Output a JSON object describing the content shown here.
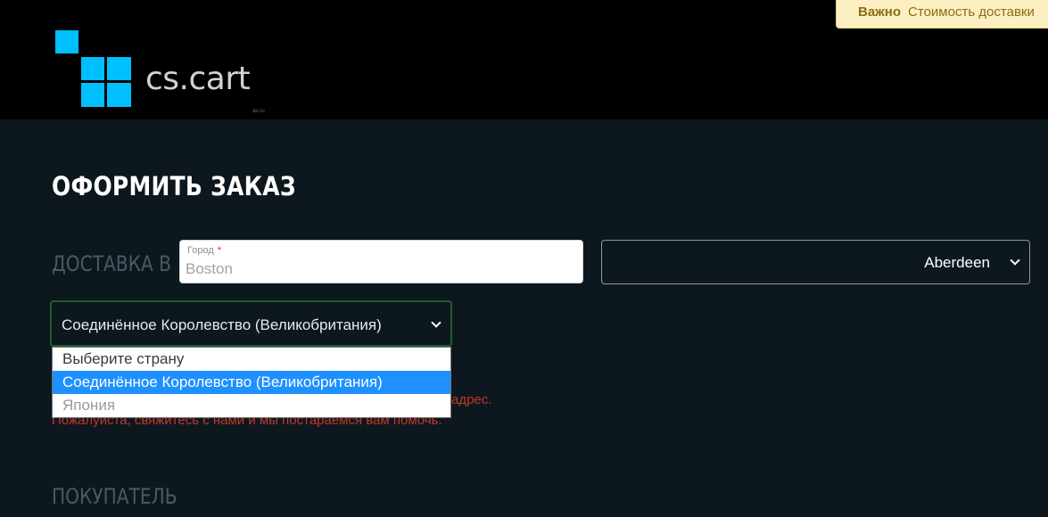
{
  "header": {
    "logo_text": "cs.cart",
    "logo_subtext": "au.ru",
    "notice": {
      "label": "Важно",
      "text": "Стоимость доставки"
    }
  },
  "page": {
    "title": "ОФОРМИТЬ ЗАКАЗ"
  },
  "shipping": {
    "section_label": "ДОСТАВКА В",
    "city": {
      "label": "Город",
      "required_mark": "*",
      "value": "Boston"
    },
    "state": {
      "value": "Aberdeen"
    },
    "country": {
      "value": "Соединённое Королевство (Великобритания)",
      "options": [
        {
          "label": "Выберите страну"
        },
        {
          "label": "Соединённое Королевство (Великобритания)"
        },
        {
          "label": "Япония"
        }
      ]
    },
    "error": {
      "line1_tail": "адрес.",
      "line2": "Пожалуйста, свяжитесь с нами и мы постараемся вам помочь."
    }
  },
  "customer": {
    "section_label": "ПОКУПАТЕЛЬ"
  }
}
